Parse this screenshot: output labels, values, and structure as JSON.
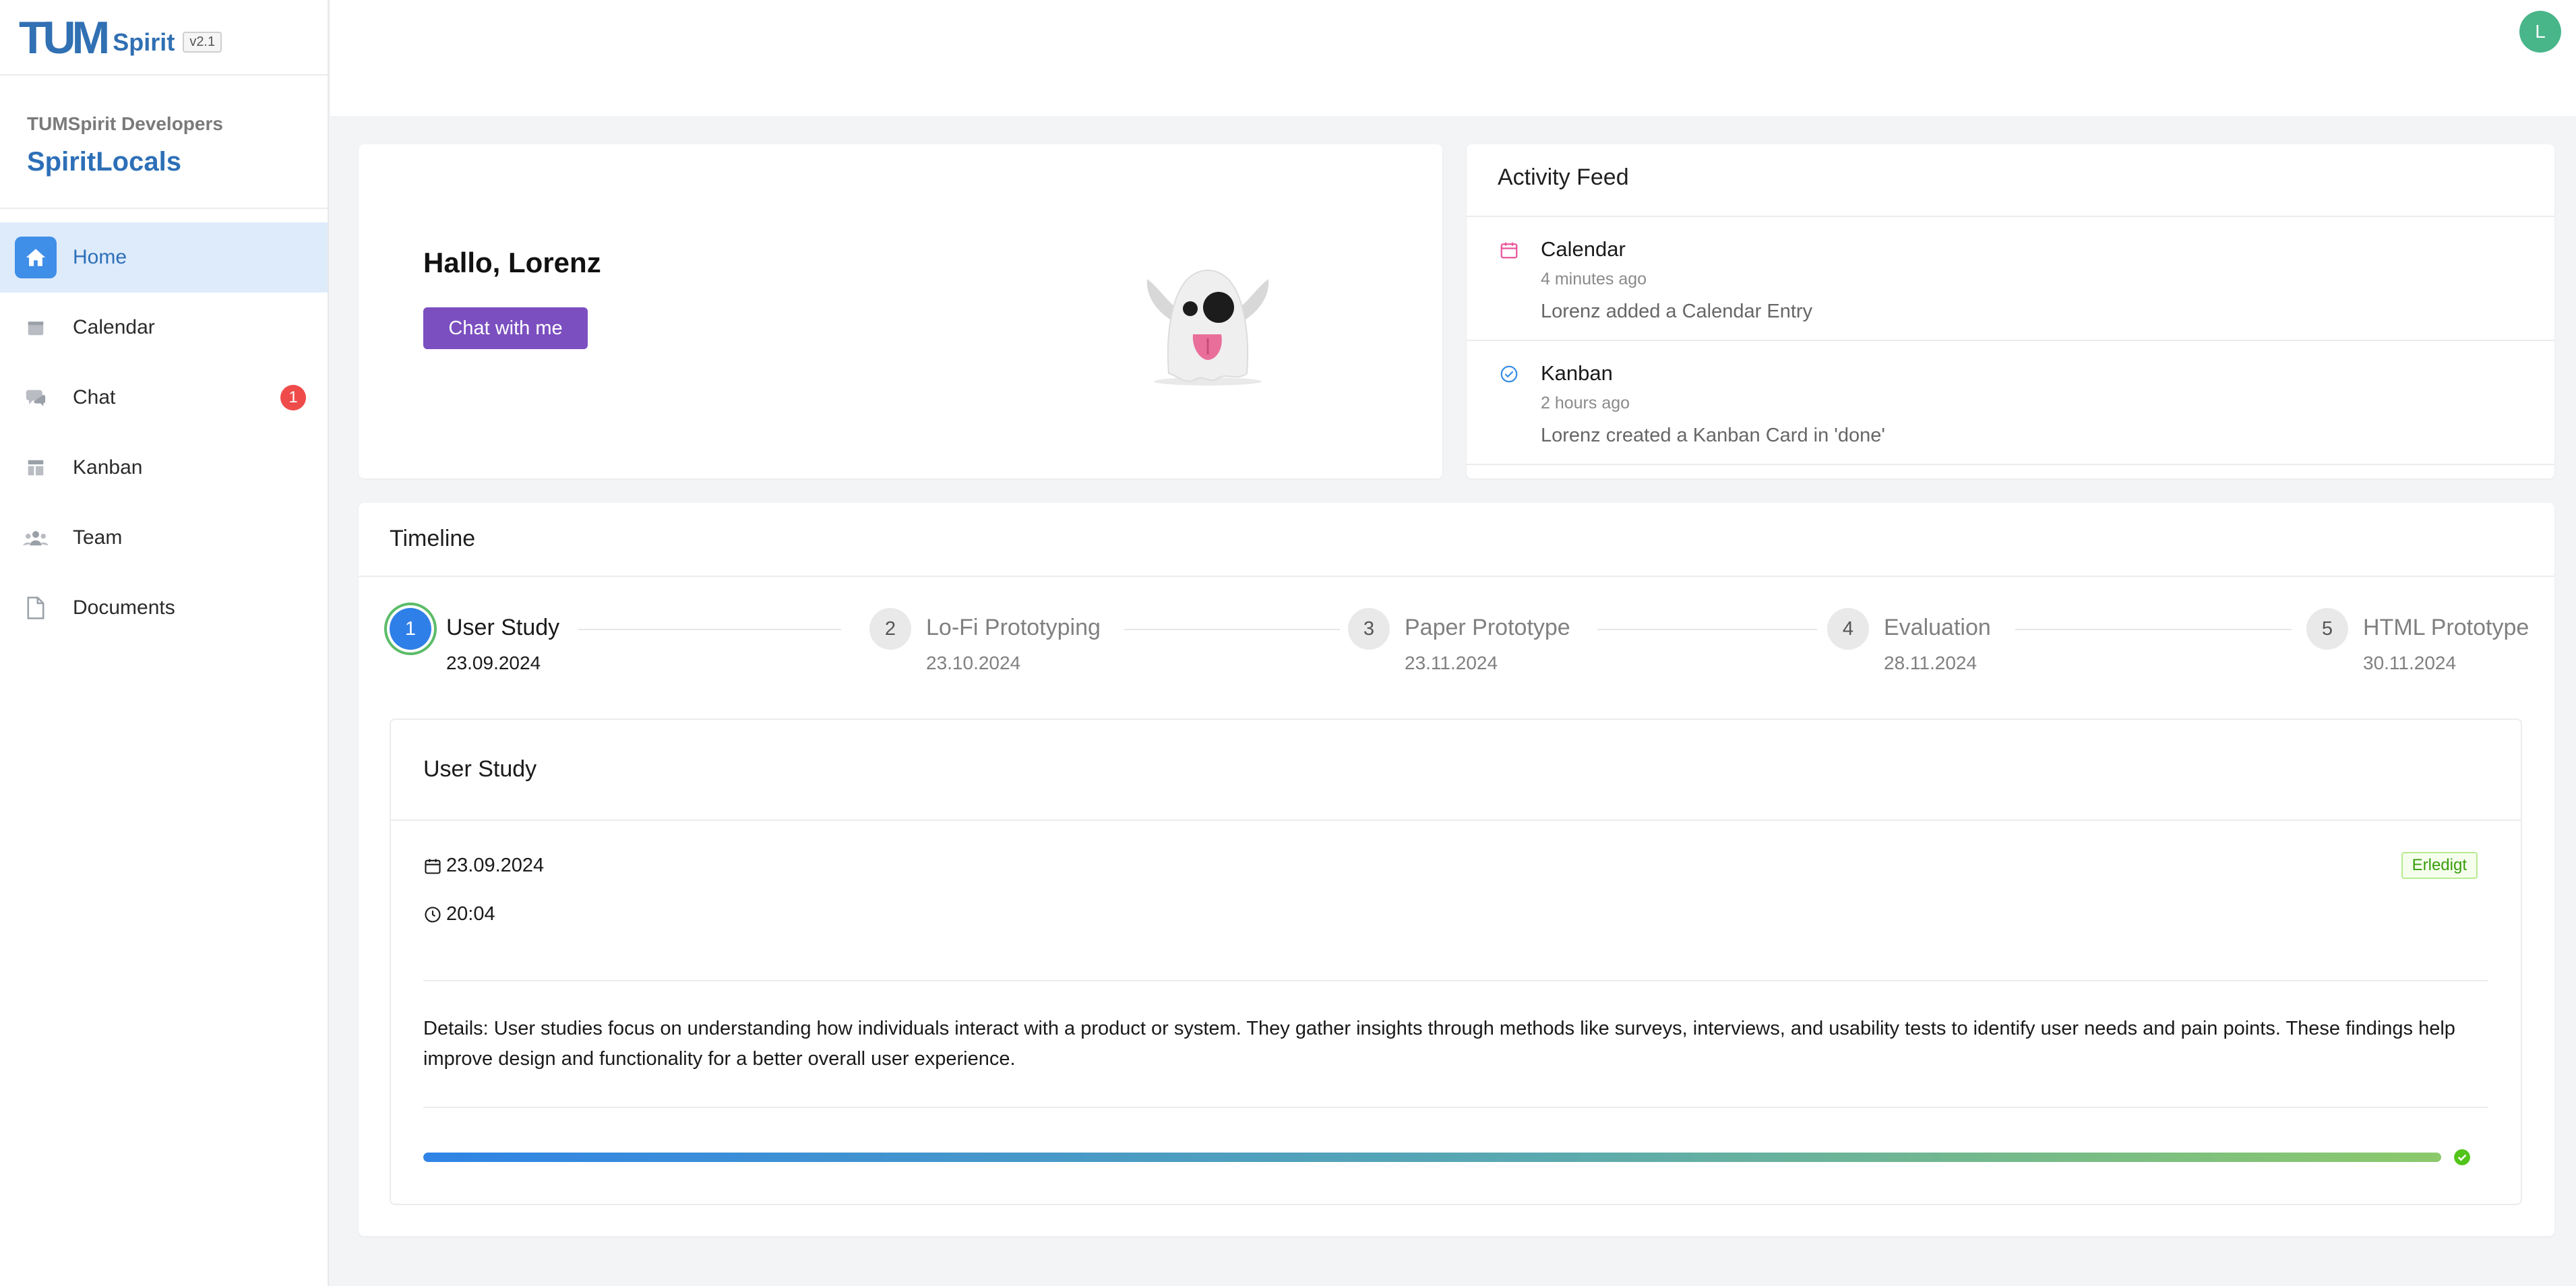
{
  "brand": {
    "logo_text": "TUM",
    "app_name": "Spirit",
    "version": "v2.1"
  },
  "sidebar": {
    "org": "TUMSpirit Developers",
    "team": "SpiritLocals",
    "items": [
      {
        "label": "Home",
        "icon": "home-icon",
        "active": true
      },
      {
        "label": "Calendar",
        "icon": "calendar-icon"
      },
      {
        "label": "Chat",
        "icon": "chat-icon",
        "badge": "1"
      },
      {
        "label": "Kanban",
        "icon": "kanban-icon"
      },
      {
        "label": "Team",
        "icon": "team-icon"
      },
      {
        "label": "Documents",
        "icon": "document-icon"
      }
    ]
  },
  "header": {
    "avatar_initial": "L"
  },
  "welcome": {
    "greeting": "Hallo, Lorenz",
    "chat_button": "Chat with me",
    "mascot": "ghost-icon"
  },
  "activity_feed": {
    "title": "Activity Feed",
    "items": [
      {
        "name": "Calendar",
        "time": "4 minutes ago",
        "description": "Lorenz added a Calendar Entry",
        "icon": "calendar-icon",
        "color": "#e8559a"
      },
      {
        "name": "Kanban",
        "time": "2 hours ago",
        "description": "Lorenz created a Kanban Card in 'done'",
        "icon": "check-circle-icon",
        "color": "#3a8ee6"
      }
    ]
  },
  "timeline": {
    "title": "Timeline",
    "steps": [
      {
        "number": "1",
        "title": "User Study",
        "date": "23.09.2024",
        "current": true
      },
      {
        "number": "2",
        "title": "Lo-Fi Prototyping",
        "date": "23.10.2024"
      },
      {
        "number": "3",
        "title": "Paper Prototype",
        "date": "23.11.2024"
      },
      {
        "number": "4",
        "title": "Evaluation",
        "date": "28.11.2024"
      },
      {
        "number": "5",
        "title": "HTML Prototype",
        "date": "30.11.2024"
      }
    ],
    "detail": {
      "title": "User Study",
      "date": "23.09.2024",
      "time": "20:04",
      "status": "Erledigt",
      "details": "Details: User studies focus on understanding how individuals interact with a product or system. They gather insights through methods like surveys, interviews, and usability tests to identify user needs and pain points. These findings help improve design and functionality for a better overall user experience.",
      "progress": 1.0
    }
  },
  "colors": {
    "primary": "#2d6fb7",
    "accent_purple": "#7b4fc0",
    "badge_red": "#ef4b4b",
    "avatar_green": "#49b68a",
    "success": "#5cbc69"
  }
}
